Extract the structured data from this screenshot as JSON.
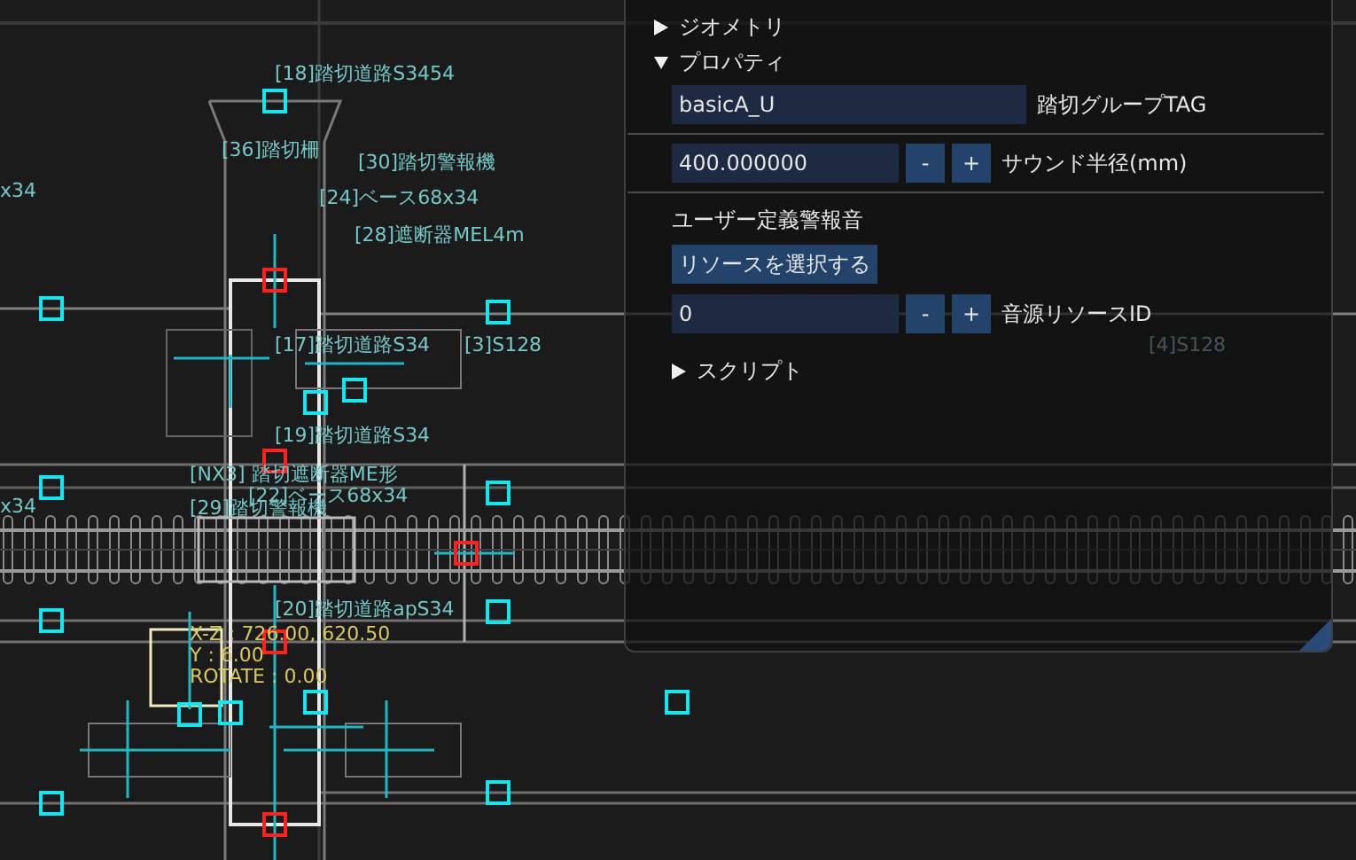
{
  "canvas": {
    "labels": [
      {
        "text": "[18]踏切道路S3454"
      },
      {
        "text": "[36]踏切柵"
      },
      {
        "text": "[30]踏切警報機"
      },
      {
        "text": "[24]ベース68x34"
      },
      {
        "text": "[28]遮断器MEL4m"
      },
      {
        "text": "x34"
      },
      {
        "text": "[17]踏切道路S34"
      },
      {
        "text": "[3]S128"
      },
      {
        "text": "[4]S128"
      },
      {
        "text": "[19]踏切道路S34"
      },
      {
        "text": "[NX3] 踏切遮断器ME形"
      },
      {
        "text": "[22]ベース68x34"
      },
      {
        "text": "x34"
      },
      {
        "text": "[29]踏切警報機"
      },
      {
        "text": "[20]踏切道路apS34"
      }
    ],
    "readout": [
      "X-Z : 726.00, 620.50",
      "Y : 6.00",
      "ROTATE : 0.00"
    ]
  },
  "panel": {
    "tree": [
      {
        "label": "ジオメトリ",
        "expanded": false
      },
      {
        "label": "プロパティ",
        "expanded": true,
        "rows": [
          {
            "kind": "text",
            "value": "basicA_U",
            "label": "踏切グループTAG"
          },
          {
            "kind": "number",
            "value": "400.000000",
            "minus": "-",
            "plus": "+",
            "label": "サウンド半径(mm)"
          },
          {
            "kind": "heading",
            "text": "ユーザー定義警報音"
          },
          {
            "kind": "button",
            "text": "リソースを選択する"
          },
          {
            "kind": "number",
            "value": "0",
            "minus": "-",
            "plus": "+",
            "label": "音源リソースID"
          }
        ],
        "children": [
          {
            "label": "スクリプト",
            "expanded": false
          }
        ]
      }
    ]
  }
}
